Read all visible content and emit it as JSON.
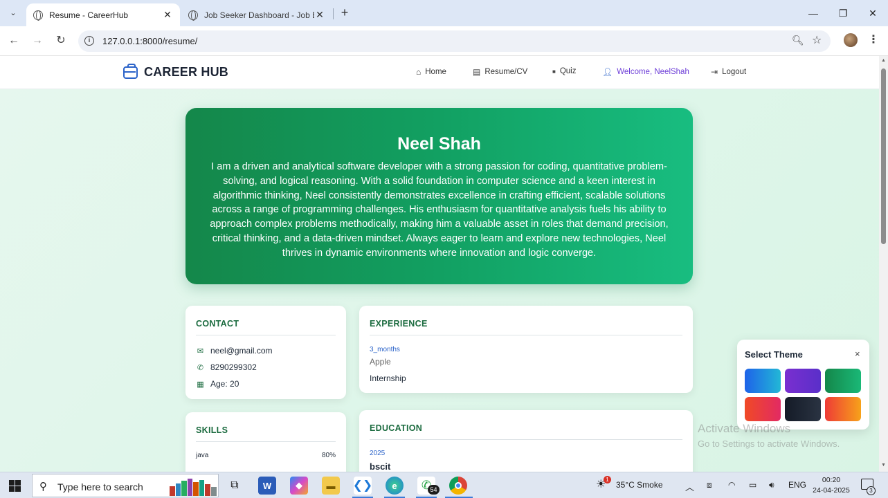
{
  "browser": {
    "tabs": [
      {
        "title": "Resume - CareerHub",
        "active": true
      },
      {
        "title": "Job Seeker Dashboard - Job Bo",
        "active": false
      }
    ],
    "url": "127.0.0.1:8000/resume/",
    "window_controls": {
      "minimize": "—",
      "restore": "❐",
      "close": "✕"
    }
  },
  "site": {
    "brand": "CAREER HUB",
    "nav": [
      {
        "label": "Home",
        "icon": "home-icon"
      },
      {
        "label": "Resume/CV",
        "icon": "document-icon"
      },
      {
        "label": "Quiz",
        "icon": "quiz-icon"
      },
      {
        "label": "Welcome, NeelShah",
        "icon": "user-icon"
      },
      {
        "label": "Logout",
        "icon": "logout-icon"
      }
    ]
  },
  "profile": {
    "name": "Neel Shah",
    "bio": "I am a driven and analytical software developer with a strong passion for coding, quantitative problem-solving, and logical reasoning. With a solid foundation in computer science and a keen interest in algorithmic thinking, Neel consistently demonstrates excellence in crafting efficient, scalable solutions across a range of programming challenges. His enthusiasm for quantitative analysis fuels his ability to approach complex problems methodically, making him a valuable asset in roles that demand precision, critical thinking, and a data-driven mindset. Always eager to learn and explore new technologies, Neel thrives in dynamic environments where innovation and logic converge."
  },
  "contact": {
    "title": "CONTACT",
    "email": "neel@gmail.com",
    "phone": "8290299302",
    "age": "Age: 20"
  },
  "skills": {
    "title": "SKILLS",
    "items": [
      {
        "name": "java",
        "percent": "80%"
      }
    ]
  },
  "experience": {
    "title": "EXPERIENCE",
    "items": [
      {
        "duration": "3_months",
        "company": "Apple",
        "role": "Internship"
      }
    ]
  },
  "education": {
    "title": "EDUCATION",
    "items": [
      {
        "year": "2025",
        "degree": "bscit"
      }
    ]
  },
  "theme_panel": {
    "title": "Select Theme",
    "close": "×",
    "themes": [
      {
        "name": "blue",
        "from": "#1e63e9",
        "to": "#22b7d6"
      },
      {
        "name": "purple",
        "from": "#7a2fd0",
        "to": "#5a2fc9"
      },
      {
        "name": "green",
        "from": "#14874a",
        "to": "#1ab877"
      },
      {
        "name": "red",
        "from": "#f04a26",
        "to": "#e22a63"
      },
      {
        "name": "dark",
        "from": "#141b27",
        "to": "#2a3342"
      },
      {
        "name": "orange",
        "from": "#ee3b36",
        "to": "#f7a21a"
      }
    ]
  },
  "watermark": {
    "line1": "Activate Windows",
    "line2": "Go to Settings to activate Windows."
  },
  "taskbar": {
    "search_placeholder": "Type here to search",
    "weather": "35°C  Smoke",
    "weather_badge": "1",
    "whatsapp_badge": "54",
    "language": "ENG",
    "time": "00:20",
    "date": "24-04-2025",
    "notifications": "3"
  }
}
